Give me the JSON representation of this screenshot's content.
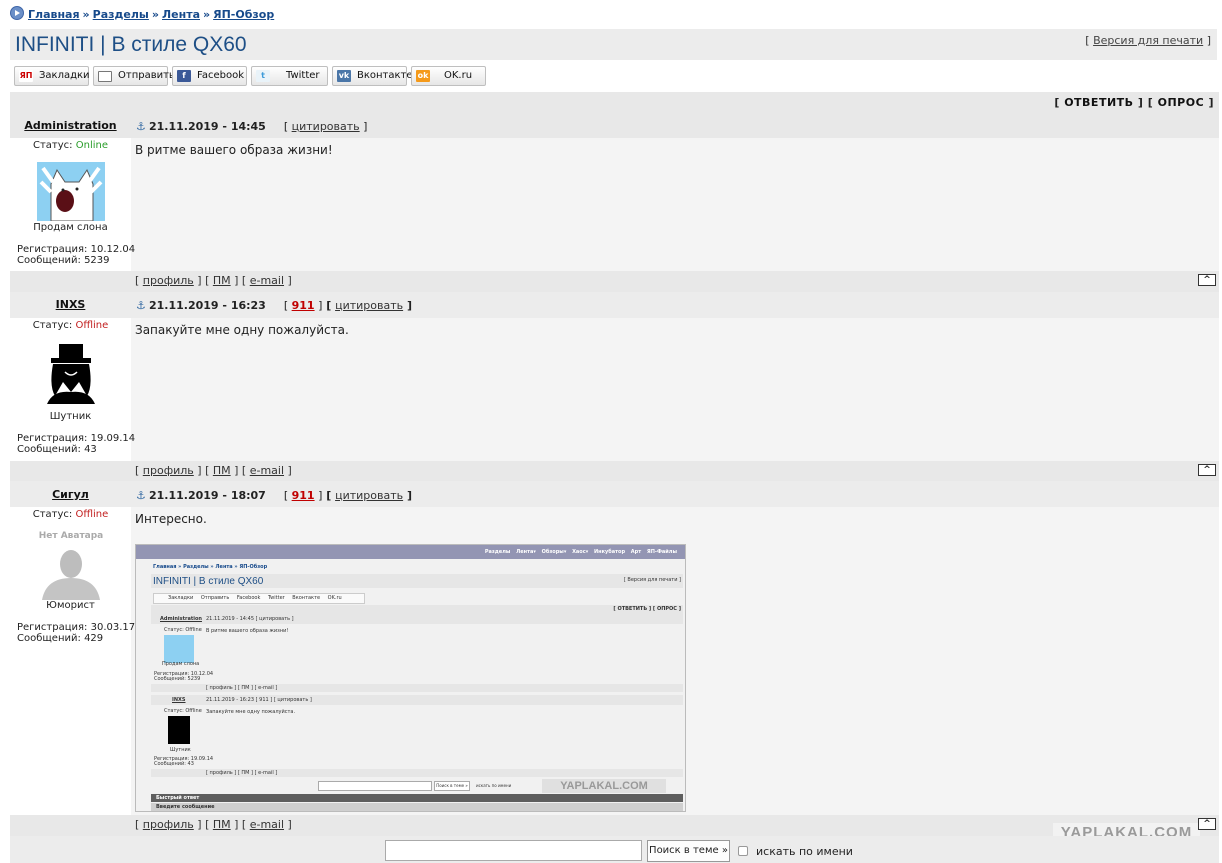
{
  "breadcrumb": {
    "items": [
      "Главная",
      "Разделы",
      "Лента",
      "ЯП-Обзор"
    ],
    "sep": "»"
  },
  "topic": {
    "title": "INFINITI | В стиле QX60",
    "print_version": "Версия для печати"
  },
  "share": {
    "buttons": [
      {
        "icon": "yap-icon",
        "label": "Закладки"
      },
      {
        "icon": "mail-icon",
        "label": "Отправить"
      },
      {
        "icon": "facebook-icon",
        "label": "Facebook"
      },
      {
        "icon": "twitter-icon",
        "label": "Twitter"
      },
      {
        "icon": "vk-icon",
        "label": "Вконтакте"
      },
      {
        "icon": "ok-icon",
        "label": "OK.ru"
      }
    ]
  },
  "actions": {
    "reply": "ОТВЕТИТЬ",
    "poll": "ОПРОС"
  },
  "labels": {
    "status": "Статус:",
    "registration": "Регистрация:",
    "messages": "Сообщений:",
    "quote": "цитировать",
    "profile": "профиль",
    "pm": "ПМ",
    "email": "e-mail",
    "up": "^"
  },
  "posts": [
    {
      "author": "Administration",
      "date": "21.11.2019 - 14:45",
      "rating": "",
      "status": "Online",
      "rank": "Продам слона",
      "reg": "10.12.04",
      "count": "5239",
      "text": "В ритме вашего образа жизни!"
    },
    {
      "author": "INXS",
      "date": "21.11.2019 - 16:23",
      "rating": "911",
      "status": "Offline",
      "rank": "Шутник",
      "reg": "19.09.14",
      "count": "43",
      "text": "Запакуйте мне одну пожалуйста."
    },
    {
      "author": "Сигул",
      "date": "21.11.2019 - 18:07",
      "rating": "911",
      "status": "Offline",
      "rank": "Юморист",
      "reg": "30.03.17",
      "count": "429",
      "text": "Интересно.",
      "no_avatar": "Нет Аватара"
    }
  ],
  "embedded": {
    "nav": "Разделы  Лента▾  Обзоры▾  Хаос▾  Инкубатор  Арт  ЯП-Файлы",
    "crumbs": "Главная » Разделы » Лента » ЯП-Обзор",
    "title": "INFINITI | В стиле QX60",
    "print": "[ Версия для печати ]",
    "share": "Закладки   Отправить   Facebook   Twitter   Вконтакте   OK.ru",
    "actions": "[ ОТВЕТИТЬ ] [ ОПРОС ]",
    "p1_author": "Administration",
    "p1_meta": "21.11.2019 - 14:45   [ цитировать ]",
    "p1_status": "Статус: Offline",
    "p1_rank": "Продам слона",
    "p1_reg": "Регистрация: 10.12.04",
    "p1_count": "Сообщений: 5239",
    "p1_text": "В ритме вашего образа жизни!",
    "links": "[ профиль ] [ ПМ ] [ e-mail ]",
    "p2_author": "INXS",
    "p2_meta": "21.11.2019 - 16:23   [ 911 ] [ цитировать ]",
    "p2_status": "Статус: Offline",
    "p2_rank": "Шутник",
    "p2_reg": "Регистрация: 19.09.14",
    "p2_count": "Сообщений: 43",
    "p2_text": "Запакуйте мне одну пожалуйста.",
    "search_btn": "Поиск в теме »",
    "search_name": "искать по имени",
    "fast_reply": "Быстрый ответ",
    "enter_msg": "Введите сообщение",
    "watermark": "YAPLAKAL.COM"
  },
  "footer": {
    "search_button": "Поиск в теме »",
    "search_by_name": "искать по имени",
    "watermark": "YAPLAKAL.COM"
  }
}
